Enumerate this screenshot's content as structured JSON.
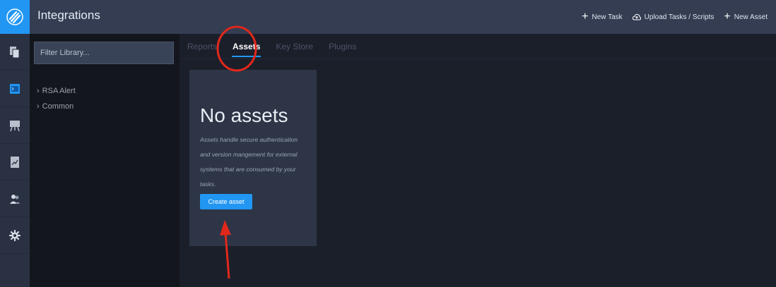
{
  "app": {
    "title": "Integrations"
  },
  "header": {
    "actions": [
      {
        "label": "New Task",
        "icon": "plus-icon"
      },
      {
        "label": "Upload Tasks / Scripts",
        "icon": "cloud-upload-icon"
      },
      {
        "label": "New Asset",
        "icon": "plus-icon"
      }
    ]
  },
  "rail": {
    "items": [
      {
        "icon": "documents-icon",
        "active": false
      },
      {
        "icon": "terminal-icon",
        "active": true
      },
      {
        "icon": "easel-icon",
        "active": false
      },
      {
        "icon": "report-icon",
        "active": false
      },
      {
        "icon": "users-icon",
        "active": false
      },
      {
        "icon": "gear-icon",
        "active": false
      }
    ]
  },
  "library": {
    "filter_placeholder": "Filter Library...",
    "items": [
      {
        "label": "RSA Alert"
      },
      {
        "label": "Common"
      }
    ]
  },
  "tabs": [
    {
      "label": "Reports",
      "active": false
    },
    {
      "label": "Assets",
      "active": true
    },
    {
      "label": "Key Store",
      "active": false
    },
    {
      "label": "Plugins",
      "active": false
    }
  ],
  "empty_state": {
    "title": "No assets",
    "description": "Assets handle secure authentication and version mangement for external systems that are consumed by your tasks.",
    "button_label": "Create asset"
  },
  "colors": {
    "accent": "#2196f3",
    "annotation": "#e0281b"
  }
}
